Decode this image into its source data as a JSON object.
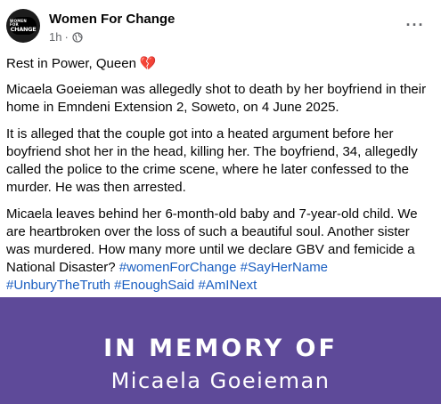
{
  "post": {
    "page_name": "Women For Change",
    "avatar_text_line1": "WOMEN FOR",
    "avatar_text_line2": "CHANGE",
    "time": "1h",
    "separator": "·",
    "privacy_icon": "globe-icon",
    "more_icon": "more-options-icon",
    "more_symbol": "···"
  },
  "content": {
    "line1": "Rest in Power, Queen",
    "heart_icon": "💔",
    "para1": "Micaela Goeieman was allegedly shot to death by her boyfriend in their home in Emndeni Extension 2, Soweto, on 4 June 2025.",
    "para2": "It is alleged that the couple got into a heated argument before her boyfriend shot her in the head, killing her. The boyfriend, 34, allegedly called the police to the crime scene, where he later confessed to the murder. He was then arrested.",
    "para3_text": "Micaela leaves behind her 6-month-old baby and 7-year-old child. We are heartbroken over the loss of such a beautiful soul. Another sister was murdered. How many more until we declare GBV and femicide a National Disaster?",
    "hashtags": [
      "#womenForChange",
      "#SayHerName",
      "#UnburyTheTruth",
      "#EnoughSaid",
      "#AmINext"
    ]
  },
  "banner": {
    "title": "IN MEMORY OF",
    "name": "Micaela Goeieman",
    "background_color": "#5e4a99"
  },
  "colors": {
    "hashtag": "#1b5fc1",
    "meta_text": "#65676b"
  }
}
